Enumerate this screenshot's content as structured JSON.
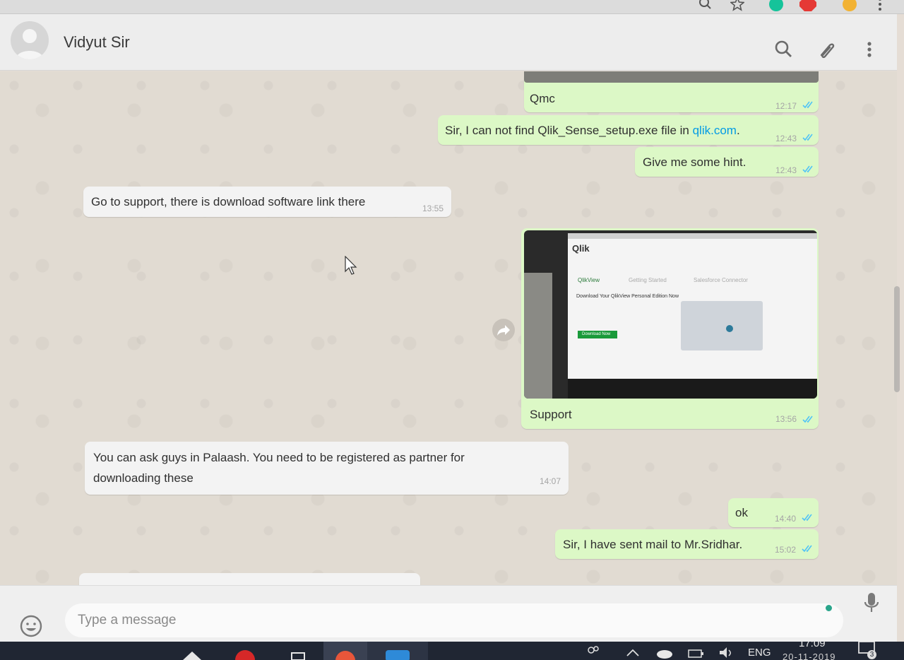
{
  "header": {
    "contact_name": "Vidyut Sir"
  },
  "messages": [
    {
      "id": "m1",
      "direction": "out",
      "text": "Qmc",
      "time": "12:17"
    },
    {
      "id": "m2",
      "direction": "out",
      "text_before": "Sir, I can not find Qlik_Sense_setup.exe file in ",
      "link": "qlik.com",
      "text_after": ".",
      "time": "12:43"
    },
    {
      "id": "m3",
      "direction": "out",
      "text": "Give me some hint.",
      "time": "12:43"
    },
    {
      "id": "m4",
      "direction": "in",
      "text": "Go to support, there is download software link there",
      "time": "13:55"
    },
    {
      "id": "m5",
      "direction": "out",
      "type": "image",
      "caption": "Support",
      "time": "13:56",
      "image_content": {
        "logo": "Qlik",
        "tabs": [
          "QlikView",
          "Getting Started",
          "Salesforce Connector"
        ],
        "heading": "Download Your QlikView Personal Edition Now",
        "button": "Download Now"
      }
    },
    {
      "id": "m6",
      "direction": "in",
      "line1": "You can ask guys in Palaash. You need to be registered as partner for",
      "line2": "downloading these",
      "time": "14:07"
    },
    {
      "id": "m7",
      "direction": "out",
      "text": "ok",
      "time": "14:40"
    },
    {
      "id": "m8",
      "direction": "out",
      "text": "Sir, I have sent mail to Mr.Sridhar.",
      "time": "15:02"
    }
  ],
  "composer": {
    "placeholder": "Type a message"
  },
  "taskbar": {
    "language": "ENG",
    "time": "17:09",
    "date": "20-11-2019",
    "notification_count": "3"
  },
  "colors": {
    "outgoing": "#dcf8c6",
    "incoming": "#f3f3f3",
    "link": "#039be5",
    "read_ticks": "#4fc3f7"
  },
  "icons": [
    "search-icon",
    "attach-icon",
    "menu-icon",
    "emoji-icon",
    "mic-icon",
    "forward-icon",
    "read-ticks-icon"
  ]
}
